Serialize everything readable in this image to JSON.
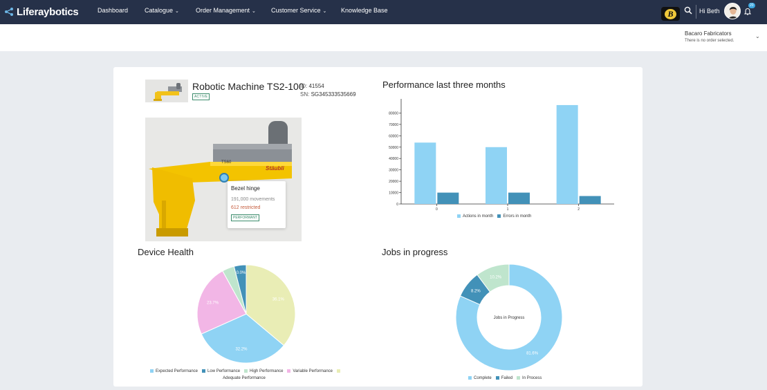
{
  "app": {
    "name": "Liferaybotics"
  },
  "nav": {
    "items": [
      {
        "label": "Dashboard",
        "has_menu": false
      },
      {
        "label": "Catalogue",
        "has_menu": true
      },
      {
        "label": "Order Management",
        "has_menu": true
      },
      {
        "label": "Customer Service",
        "has_menu": true
      },
      {
        "label": "Knowledge Base",
        "has_menu": false
      }
    ],
    "greeting": "Hi Beth",
    "notification_count": "20"
  },
  "company": {
    "logo_letter": "B",
    "name": "Bacaro Fabricators",
    "status": "There is no order selected."
  },
  "product": {
    "title": "Robotic Machine TS2-100",
    "status_badge": "ACTIVE",
    "id_label": "ID:",
    "id_value": "41554",
    "sn_label": "SN:",
    "sn_value": "SG345333535669"
  },
  "hotspot_tooltip": {
    "title": "Bezel hinge",
    "movements": "191,000 movements",
    "restricted": "612 restricted",
    "badge": "PERFORMANT"
  },
  "sections": {
    "performance": "Performance last three months",
    "device_health": "Device Health",
    "jobs": "Jobs in progress"
  },
  "colors": {
    "nav_bg": "#263149",
    "light_blue": "#8fd3f4",
    "dark_blue": "#4291b8",
    "light_green": "#bfe5cd",
    "pink": "#f2b6e6",
    "pale_yellow": "#e9edb5",
    "success_green": "#3c8c6c"
  },
  "chart_data": [
    {
      "type": "bar",
      "title": "Performance last three months",
      "categories": [
        "0",
        "1",
        "2"
      ],
      "series": [
        {
          "name": "Actions in month",
          "color": "#8fd3f4",
          "values": [
            54000,
            50000,
            87000
          ]
        },
        {
          "name": "Errors in month",
          "color": "#4291b8",
          "values": [
            10000,
            10000,
            7000
          ]
        }
      ],
      "ylim": [
        0,
        90000
      ],
      "yticks": [
        0,
        10000,
        20000,
        30000,
        40000,
        50000,
        60000,
        70000,
        80000
      ],
      "grid": false,
      "legend": "bottom"
    },
    {
      "type": "pie",
      "title": "Device Health",
      "slices": [
        {
          "name": "Expected Performance",
          "value": 0,
          "color": "#8fd3f4",
          "label": ""
        },
        {
          "name": "Low Performance",
          "value": 4.0,
          "color": "#4291b8",
          "label": "0.0%"
        },
        {
          "name": "High Performance",
          "value": 4.0,
          "color": "#bfe5cd",
          "label": ""
        },
        {
          "name": "Variable Performance",
          "value": 23.7,
          "color": "#f2b6e6",
          "label": "23.7%"
        },
        {
          "name": "Adequate Performance",
          "value": 36.1,
          "color": "#e9edb5",
          "label": "36.1%"
        }
      ],
      "slice_order": [
        4,
        0,
        3,
        2,
        1
      ],
      "blue_label": "32.2%",
      "legend": "bottom"
    },
    {
      "type": "pie",
      "title": "Jobs in progress",
      "donut": true,
      "center_label": "Jobs in Progress",
      "slices": [
        {
          "name": "Complete",
          "value": 81.6,
          "color": "#8fd3f4",
          "label": "81.6%"
        },
        {
          "name": "Failed",
          "value": 8.2,
          "color": "#4291b8",
          "label": "8.2%"
        },
        {
          "name": "In Process",
          "value": 10.2,
          "color": "#bfe5cd",
          "label": "10.2%"
        }
      ],
      "legend": "bottom"
    }
  ]
}
